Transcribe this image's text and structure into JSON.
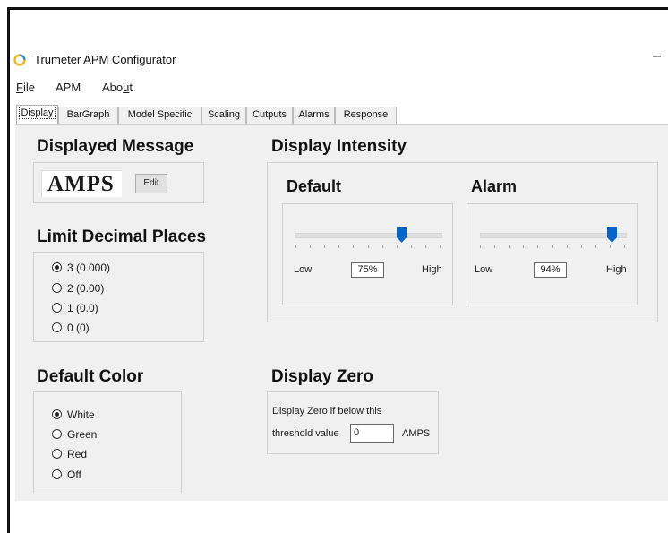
{
  "window": {
    "title": "Trumeter APM Configurator",
    "minimize_glyph": "–"
  },
  "menu": {
    "items": [
      {
        "prefix": "",
        "underline": "F",
        "suffix": "ile"
      },
      {
        "prefix": "APM",
        "underline": "",
        "suffix": ""
      },
      {
        "prefix": "Abo",
        "underline": "u",
        "suffix": "t"
      }
    ]
  },
  "tabs": [
    "Display",
    "BarGraph",
    "Model Specific",
    "Scaling",
    "Cutputs",
    "Alarms",
    "Response"
  ],
  "active_tab": "Display",
  "displayed_message": {
    "heading": "Displayed Message",
    "value": "AMPS",
    "edit_label": "Edit"
  },
  "decimal_places": {
    "heading": "Limit Decimal Places",
    "options": [
      "3 (0.000)",
      "2 (0.00)",
      "1 (0.0)",
      "0 (0)"
    ],
    "selected_index": 0
  },
  "default_color": {
    "heading": "Default Color",
    "options": [
      "White",
      "Green",
      "Red",
      "Off"
    ],
    "selected_index": 0
  },
  "display_intensity": {
    "heading": "Display Intensity",
    "default": {
      "label": "Default",
      "low_label": "Low",
      "high_label": "High",
      "value_text": "75%",
      "level": 0.75
    },
    "alarm": {
      "label": "Alarm",
      "low_label": "Low",
      "high_label": "High",
      "value_text": "94%",
      "level": 0.94
    }
  },
  "display_zero": {
    "heading": "Display Zero",
    "line1": "Display Zero if below this",
    "line2": "threshold value",
    "value": "0",
    "unit": "AMPS"
  },
  "colors": {
    "accent": "#0066cc",
    "panel_bg": "#f0f0f0",
    "border": "#cfcfcf"
  },
  "icons": {
    "app": "trumeter-logo-icon",
    "radio_on": "radio-selected-icon",
    "radio_off": "radio-empty-icon"
  }
}
